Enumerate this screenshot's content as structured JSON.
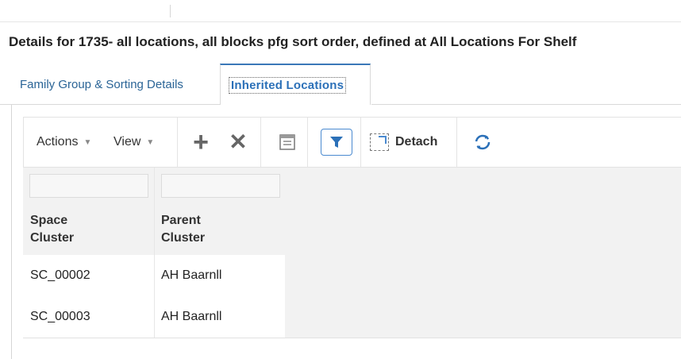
{
  "page_title": "Details for 1735- all locations, all blocks pfg sort order, defined at All Locations For Shelf",
  "tabs": [
    {
      "label": "Family Group & Sorting Details",
      "selected": false
    },
    {
      "label": "Inherited Locations",
      "selected": true
    }
  ],
  "toolbar": {
    "actions_label": "Actions",
    "view_label": "View",
    "add_icon": "+",
    "delete_icon": "✕",
    "detach_label": "Detach"
  },
  "colors": {
    "accent": "#2b70b8",
    "tab_active_border": "#3a78b8",
    "filter_border": "#4a8ad0",
    "table_background": "#f2f2f2"
  },
  "table": {
    "filter_placeholders": [
      "",
      ""
    ],
    "columns": [
      "Space\nCluster",
      "Parent\nCluster"
    ],
    "rows": [
      [
        "SC_00002",
        "AH Baarnll"
      ],
      [
        "SC_00003",
        "AH Baarnll"
      ]
    ]
  }
}
